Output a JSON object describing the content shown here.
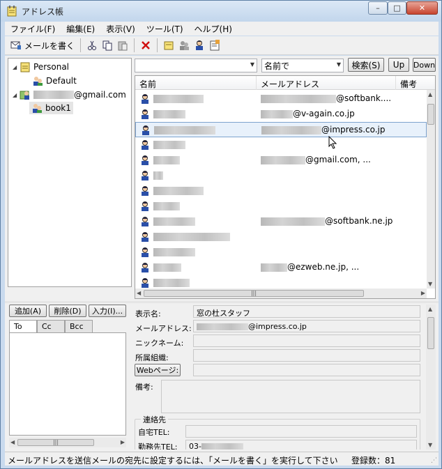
{
  "window": {
    "title": "アドレス帳",
    "controls": {
      "minimize": "–",
      "maximize": "□",
      "close": "✕"
    }
  },
  "menu": [
    "ファイル(F)",
    "編集(E)",
    "表示(V)",
    "ツール(T)",
    "ヘルプ(H)"
  ],
  "toolbar": {
    "compose_label": "メールを書く",
    "icons": [
      "compose-icon",
      "cut-icon",
      "copy-icon",
      "paste-icon",
      "delete-icon",
      "new-folder-icon",
      "new-group-icon",
      "new-contact-icon",
      "properties-icon"
    ]
  },
  "tree": {
    "personal": "Personal",
    "default": "Default",
    "gmail_suffix": "@gmail.com",
    "book1": "book1"
  },
  "search": {
    "query": "",
    "field": "名前で",
    "search_button": "検索(S)",
    "up_button": "Up",
    "down_button": "Down"
  },
  "list": {
    "columns": [
      "名前",
      "メールアドレス",
      "備考"
    ],
    "rows": [
      {
        "email": "@softbank...."
      },
      {
        "email": "@v-again.co.jp"
      },
      {
        "email": "@impress.co.jp",
        "selected": true
      },
      {
        "email": ""
      },
      {
        "email": "@gmail.com, ..."
      },
      {
        "email": ""
      },
      {
        "email": ""
      },
      {
        "email": ""
      },
      {
        "email": "@softbank.ne.jp"
      },
      {
        "email": ""
      },
      {
        "email": ""
      },
      {
        "email": "@ezweb.ne.jp, ..."
      },
      {
        "email": ""
      }
    ]
  },
  "recipients": {
    "add": "追加(A)",
    "remove": "削除(D)",
    "input": "入力(I)...",
    "tabs": [
      "To",
      "Cc",
      "Bcc"
    ]
  },
  "detail": {
    "display_name_label": "表示名:",
    "display_name": "窓の杜スタッフ",
    "email_label": "メールアドレス:",
    "email": "@impress.co.jp",
    "nickname_label": "ニックネーム:",
    "org_label": "所属組織:",
    "web_button": "Webページ:",
    "memo_label": "備考:",
    "contact_group": "連絡先",
    "home_tel_label": "自宅TEL:",
    "work_tel_label": "勤務先TEL:",
    "work_tel_prefix": "03-"
  },
  "status": {
    "message": "メールアドレスを送信メールの宛先に設定するには、「メールを書く」を実行して下さい",
    "count_label": "登録数：",
    "count": "81"
  }
}
